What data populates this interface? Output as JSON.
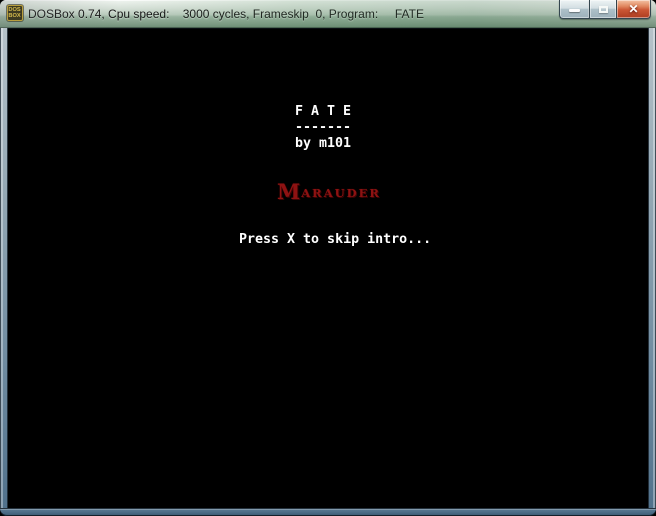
{
  "window": {
    "title": "DOSBox 0.74, Cpu speed:    3000 cycles, Frameskip  0, Program:     FATE",
    "icon": {
      "line1": "DOS",
      "line2": "BOX"
    },
    "controls": {
      "close_glyph": "✕"
    }
  },
  "screen": {
    "game_title": "F A T E",
    "underline": "-------",
    "byline": "by m101",
    "logo_cap": "M",
    "logo_rest": "ARAUDER",
    "prompt": "Press X to skip intro...",
    "colors": {
      "background": "#000000",
      "text": "#ffffff",
      "logo_red": "#8e1212",
      "titlebar_green": "#7d9a84",
      "frame_blue": "#4c6c86"
    }
  }
}
